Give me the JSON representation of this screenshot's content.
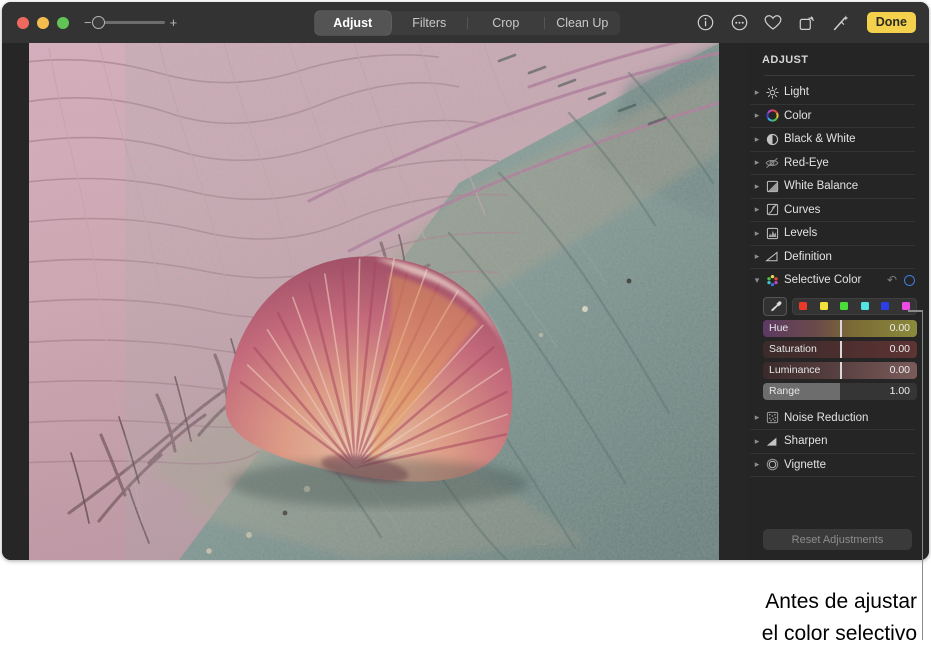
{
  "window": {
    "traffic_lights": [
      "close",
      "minimize",
      "zoom"
    ],
    "zoom_control": {
      "minus": "−",
      "plus": "+",
      "value": 0
    }
  },
  "toolbar": {
    "tabs": [
      {
        "label": "Adjust",
        "active": true
      },
      {
        "label": "Filters",
        "active": false
      },
      {
        "label": "Crop",
        "active": false
      },
      {
        "label": "Clean Up",
        "active": false
      }
    ],
    "icons": [
      {
        "name": "info-icon",
        "glyph": "ⓘ"
      },
      {
        "name": "more-options-icon",
        "glyph": "⋯"
      },
      {
        "name": "favorite-heart-icon",
        "glyph": "♡"
      },
      {
        "name": "rotate-icon",
        "glyph": "↻"
      },
      {
        "name": "auto-enhance-wand-icon",
        "glyph": "✦"
      }
    ],
    "done_label": "Done"
  },
  "panel": {
    "title": "ADJUST",
    "items": [
      {
        "label": "Light",
        "icon": "light-icon",
        "expanded": false
      },
      {
        "label": "Color",
        "icon": "color-wheel-icon",
        "expanded": false
      },
      {
        "label": "Black & White",
        "icon": "black-and-white-icon",
        "expanded": false
      },
      {
        "label": "Red-Eye",
        "icon": "red-eye-icon",
        "expanded": false
      },
      {
        "label": "White Balance",
        "icon": "white-balance-icon",
        "expanded": false
      },
      {
        "label": "Curves",
        "icon": "curves-icon",
        "expanded": false
      },
      {
        "label": "Levels",
        "icon": "levels-icon",
        "expanded": false
      },
      {
        "label": "Definition",
        "icon": "definition-icon",
        "expanded": false
      }
    ],
    "selective_color": {
      "label": "Selective Color",
      "icon": "selective-color-icon",
      "expanded": true,
      "reset_icon": "reset-arrow-icon",
      "toggle_icon": "enable-toggle-circle-icon",
      "toggle_color": "#3d7ce0",
      "eyedropper_icon": "eyedropper-icon",
      "swatches": [
        {
          "name": "swatch-red",
          "color": "#e8392a"
        },
        {
          "name": "swatch-yellow",
          "color": "#f2e23b"
        },
        {
          "name": "swatch-green",
          "color": "#4ade3a"
        },
        {
          "name": "swatch-cyan",
          "color": "#52e3e3"
        },
        {
          "name": "swatch-blue",
          "color": "#2a3fe8"
        },
        {
          "name": "swatch-magenta",
          "color": "#ee4ae8"
        }
      ],
      "sliders": [
        {
          "label": "Hue",
          "value": "0.00",
          "knob_pct": 50,
          "gradient": "linear-gradient(90deg,#5d3a63 0%,#6b4a4a 35%,#7b6a35 58%,#8a8a3c 100%)"
        },
        {
          "label": "Saturation",
          "value": "0.00",
          "knob_pct": 50,
          "gradient": "linear-gradient(90deg,#3b2b2b 0%,#4a2e2e 45%,#5e3333 100%)"
        },
        {
          "label": "Luminance",
          "value": "0.00",
          "knob_pct": 50,
          "gradient": "linear-gradient(90deg,#3a2a2a 0%,#5a4141 50%,#7a5b5b 100%)"
        },
        {
          "label": "Range",
          "value": "1.00",
          "knob_pct": 0,
          "gradient": "linear-gradient(90deg,#6d6d6e 0%,#6d6d6e 50%,#353536 50%,#353536 100%)"
        }
      ]
    },
    "items_bottom": [
      {
        "label": "Noise Reduction",
        "icon": "noise-reduction-icon",
        "expanded": false
      },
      {
        "label": "Sharpen",
        "icon": "sharpen-icon",
        "expanded": false
      },
      {
        "label": "Vignette",
        "icon": "vignette-icon",
        "expanded": false
      }
    ],
    "reset_button": "Reset Adjustments"
  },
  "photo": {
    "description": "scallop-shell-on-teal-towel-photo"
  },
  "caption": {
    "line1": "Antes de ajustar",
    "line2": "el color selectivo"
  }
}
